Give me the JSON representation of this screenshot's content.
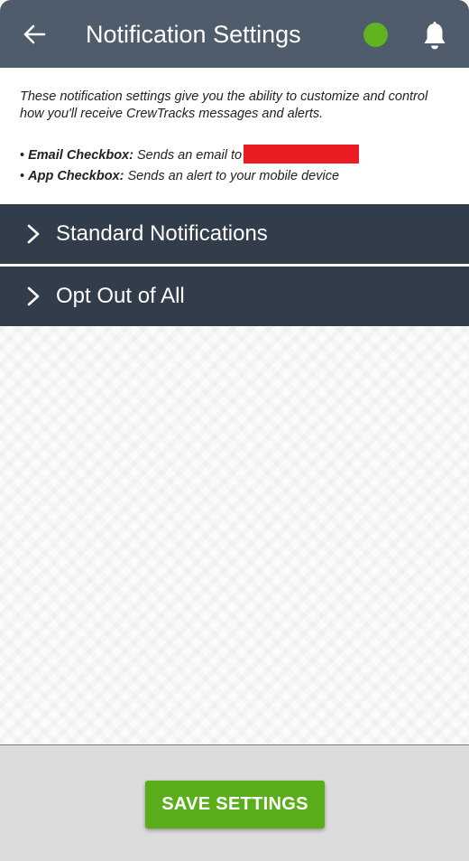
{
  "header": {
    "title": "Notification Settings",
    "back_icon": "arrow-left-icon",
    "status_icon": "status-dot",
    "status_color": "#5fb41e",
    "bell_icon": "bell-icon",
    "background": "#4e5c6b"
  },
  "intro": {
    "text": "These notification settings give you the ability to customize and control how you'll receive CrewTracks messages and alerts."
  },
  "bullets": [
    {
      "marker": "•",
      "label": "Email Checkbox:",
      "text": "Sends an email to"
    },
    {
      "marker": "•",
      "label": "App Checkbox:",
      "text": "Sends an alert to your mobile device"
    }
  ],
  "sections": [
    {
      "label": "Standard Notifications",
      "icon": "chevron-right-icon"
    },
    {
      "label": "Opt Out of All",
      "icon": "chevron-right-icon"
    }
  ],
  "footer": {
    "save_label": "SAVE SETTINGS",
    "save_color": "#5aae1c"
  }
}
